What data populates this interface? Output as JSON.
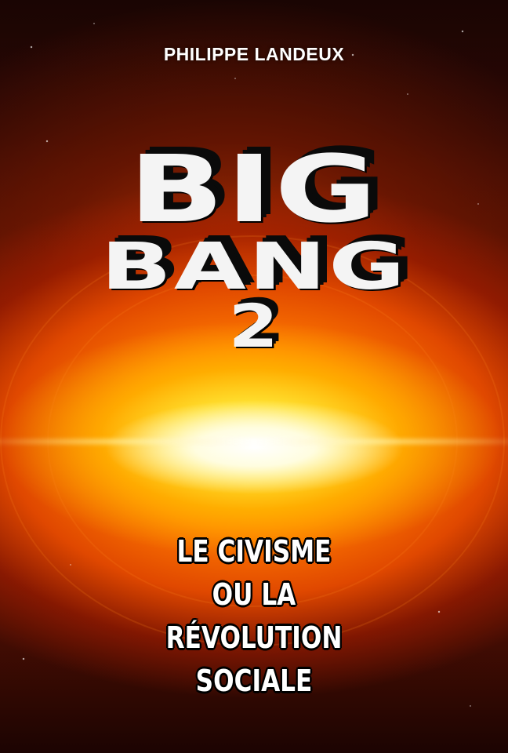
{
  "cover": {
    "author": "PHILIPPE LANDEUX",
    "title_line1": "BIG",
    "title_line2": "BANG",
    "title_number": "2",
    "subtitle_lines": [
      "LE CIVISME",
      "OU LA",
      "RÉVOLUTION",
      "SOCIALE"
    ]
  },
  "colors": {
    "background": "#1a0503",
    "explosion_core": "#fff8a0",
    "explosion_mid": "#ff7a00",
    "title_fill": "#f4f4f4",
    "title_shadow": "#0a0a0a"
  }
}
